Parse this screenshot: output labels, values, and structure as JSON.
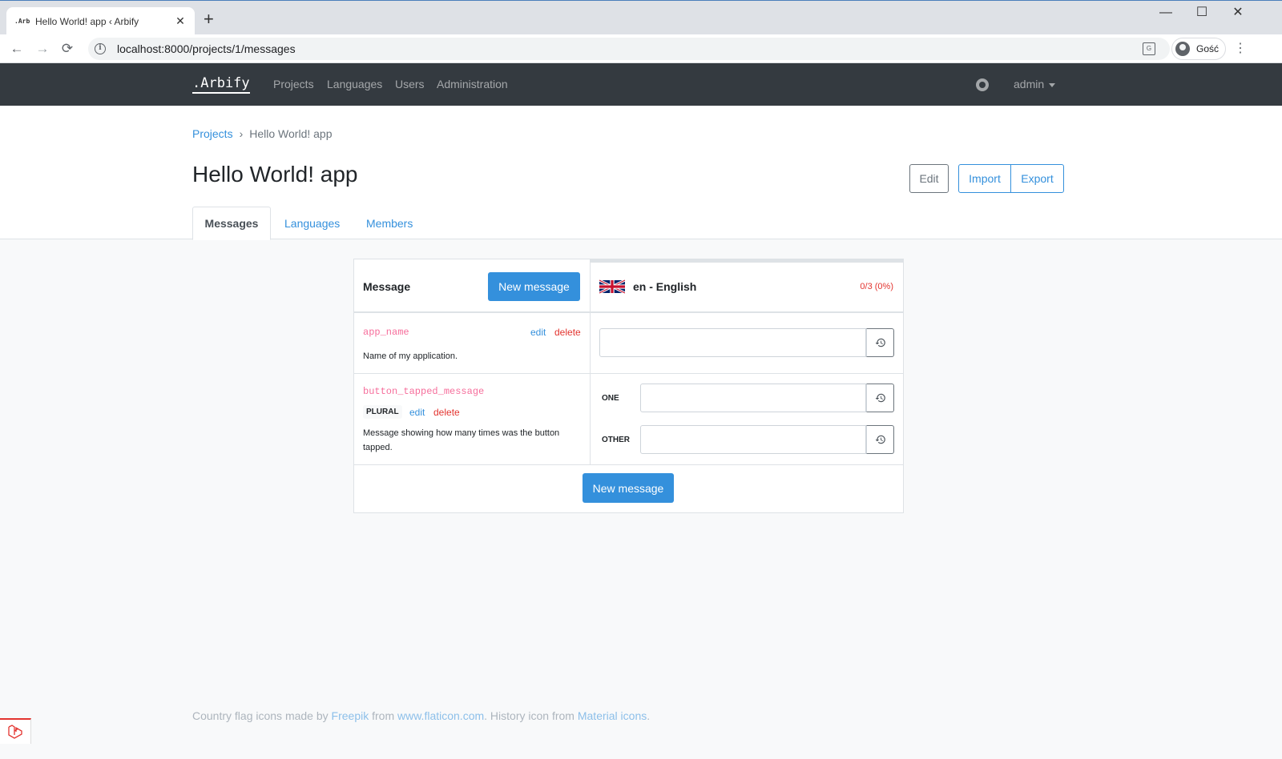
{
  "browser": {
    "tab_favicon": ".Arb",
    "tab_title": "Hello World! app ‹ Arbify",
    "tab_close": "✕",
    "new_tab": "+",
    "url": "localhost:8000/projects/1/messages",
    "profile_name": "Gość",
    "minimize": "—",
    "maximize": "☐",
    "close": "✕",
    "back": "←",
    "forward": "→",
    "reload": "⟳",
    "menu": "⋮"
  },
  "navbar": {
    "brand": ".Arbify",
    "links": [
      "Projects",
      "Languages",
      "Users",
      "Administration"
    ],
    "user": "admin"
  },
  "breadcrumb": {
    "root": "Projects",
    "separator": "›",
    "current": "Hello World! app"
  },
  "page": {
    "title": "Hello World! app",
    "edit": "Edit",
    "import": "Import",
    "export": "Export",
    "tabs": [
      "Messages",
      "Languages",
      "Members"
    ]
  },
  "table": {
    "header_message": "Message",
    "new_message": "New message",
    "language": "en - English",
    "progress": "0/3 (0%)",
    "progress_color": "#e3342f",
    "messages": [
      {
        "key": "app_name",
        "edit": "edit",
        "delete": "delete",
        "description": "Name of my application."
      },
      {
        "key": "button_tapped_message",
        "type": "PLURAL",
        "edit": "edit",
        "delete": "delete",
        "description_line1": "Message showing how many times was the button",
        "description_line2": "tapped.",
        "forms": [
          "ONE",
          "OTHER"
        ]
      }
    ]
  },
  "footer": {
    "t1": "Country flag icons made by ",
    "freepik": "Freepik",
    "t2": " from ",
    "flaticon": "www.flaticon.com",
    "t3": ". History icon from ",
    "material": "Material icons",
    "t4": "."
  },
  "colors": {
    "primary": "#3490dc",
    "danger": "#e3342f",
    "navbar": "#343a40",
    "code": "#f66d9b"
  }
}
